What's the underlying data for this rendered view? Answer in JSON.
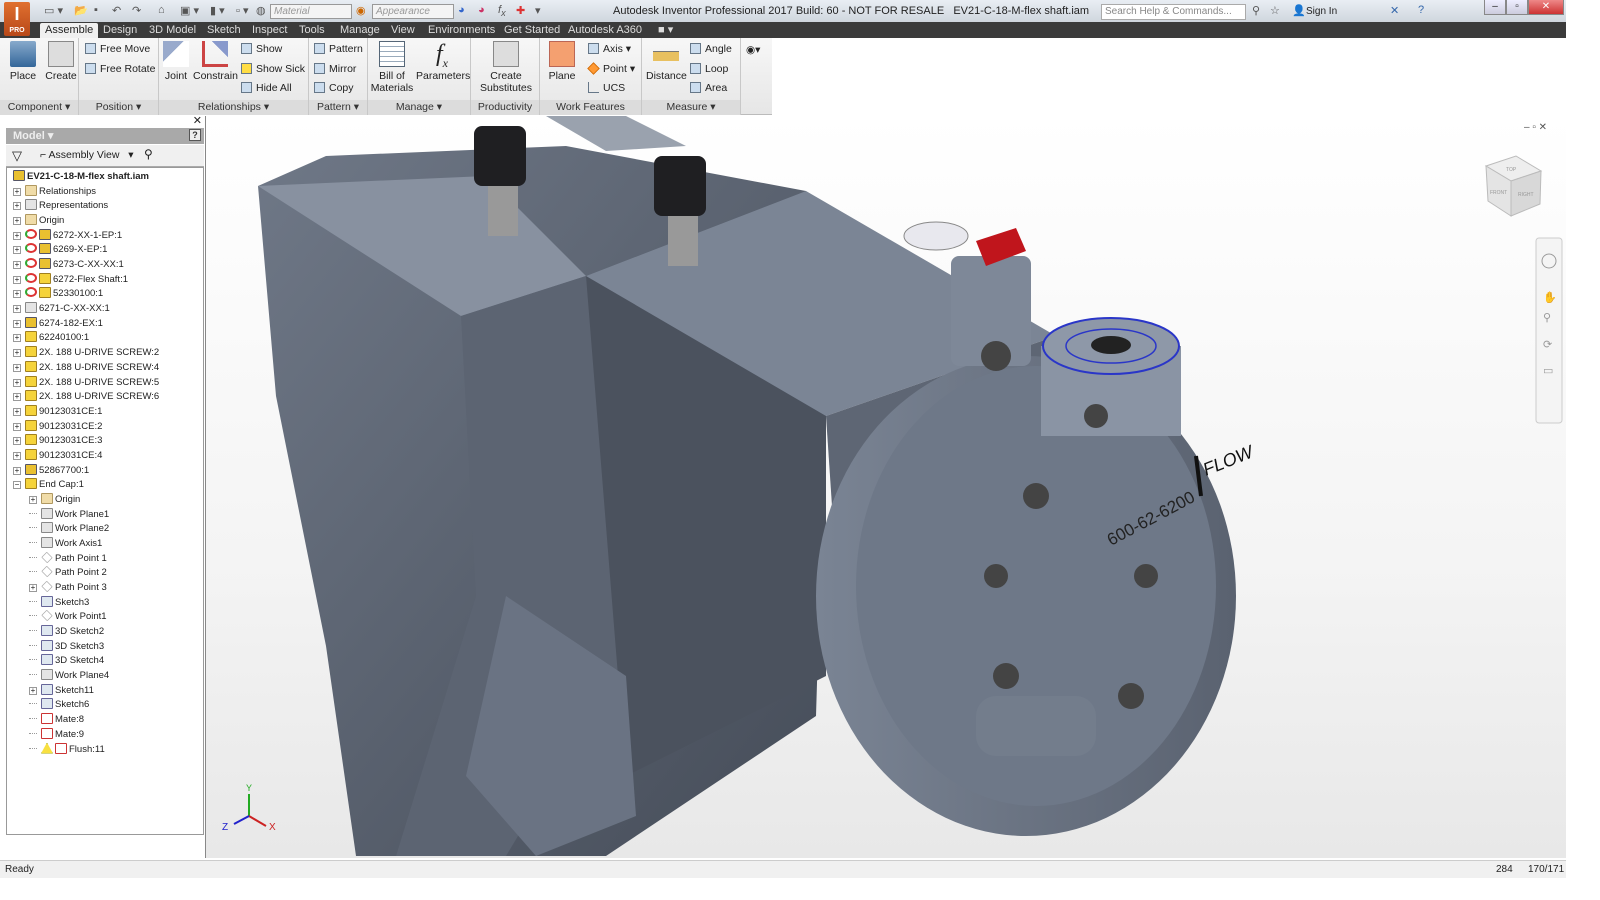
{
  "app": {
    "logo": "I",
    "edition": "PRO",
    "title": "Autodesk Inventor Professional 2017 Build: 60 - NOT FOR RESALE   EV21-C-18-M-flex shaft.iam"
  },
  "qat": {
    "material": "Material",
    "appearance": "Appearance"
  },
  "help": {
    "search_placeholder": "Search Help & Commands...",
    "sign_in": "Sign In"
  },
  "tabs": [
    "Assemble",
    "Design",
    "3D Model",
    "Sketch",
    "Inspect",
    "Tools",
    "Manage",
    "View",
    "Environments",
    "Get Started",
    "Autodesk A360"
  ],
  "ribbon": {
    "component": {
      "title": "Component ▾",
      "place": "Place",
      "create": "Create"
    },
    "position": {
      "title": "Position ▾",
      "free_move": "Free Move",
      "free_rotate": "Free Rotate"
    },
    "relationships": {
      "title": "Relationships ▾",
      "joint": "Joint",
      "constrain": "Constrain",
      "show": "Show",
      "show_sick": "Show Sick",
      "hide_all": "Hide All"
    },
    "pattern": {
      "title": "Pattern ▾",
      "pattern": "Pattern",
      "mirror": "Mirror",
      "copy": "Copy"
    },
    "manage": {
      "title": "Manage ▾",
      "bom": "Bill of Materials",
      "parameters": "Parameters"
    },
    "productivity": {
      "title": "Productivity",
      "create_substitutes": "Create Substitutes"
    },
    "work_features": {
      "title": "Work Features",
      "plane": "Plane",
      "axis": "Axis ▾",
      "point": "Point ▾",
      "ucs": "UCS"
    },
    "measure": {
      "title": "Measure ▾",
      "distance": "Distance",
      "angle": "Angle",
      "loop": "Loop",
      "area": "Area"
    }
  },
  "browser": {
    "header": "Model ▾",
    "view": "Assembly View",
    "tree": [
      {
        "label": "EV21-C-18-M-flex shaft.iam",
        "lvl": 0,
        "icon": "asm",
        "root": true
      },
      {
        "label": "Relationships",
        "lvl": 0,
        "icon": "folder",
        "exp": "+"
      },
      {
        "label": "Representations",
        "lvl": 0,
        "icon": "work",
        "exp": "+"
      },
      {
        "label": "Origin",
        "lvl": 0,
        "icon": "folder",
        "exp": "+"
      },
      {
        "label": "6272-XX-1-EP:1",
        "lvl": 0,
        "icon": "asm",
        "exp": "+",
        "sub": true
      },
      {
        "label": "6269-X-EP:1",
        "lvl": 0,
        "icon": "asm",
        "exp": "+",
        "sub": true
      },
      {
        "label": "6273-C-XX-XX:1",
        "lvl": 0,
        "icon": "asm",
        "exp": "+",
        "sub": true
      },
      {
        "label": "6272-Flex Shaft:1",
        "lvl": 0,
        "icon": "part",
        "exp": "+",
        "sub": true
      },
      {
        "label": "52330100:1",
        "lvl": 0,
        "icon": "part",
        "exp": "+",
        "sub": true
      },
      {
        "label": "6271-C-XX-XX:1",
        "lvl": 0,
        "icon": "work",
        "exp": "+"
      },
      {
        "label": "6274-182-EX:1",
        "lvl": 0,
        "icon": "asm",
        "exp": "+"
      },
      {
        "label": "62240100:1",
        "lvl": 0,
        "icon": "part",
        "exp": "+"
      },
      {
        "label": "2X. 188 U-DRIVE SCREW:2",
        "lvl": 0,
        "icon": "part",
        "exp": "+"
      },
      {
        "label": "2X. 188 U-DRIVE SCREW:4",
        "lvl": 0,
        "icon": "part",
        "exp": "+"
      },
      {
        "label": "2X. 188 U-DRIVE SCREW:5",
        "lvl": 0,
        "icon": "part",
        "exp": "+"
      },
      {
        "label": "2X. 188 U-DRIVE SCREW:6",
        "lvl": 0,
        "icon": "part",
        "exp": "+"
      },
      {
        "label": "90123031CE:1",
        "lvl": 0,
        "icon": "part",
        "exp": "+"
      },
      {
        "label": "90123031CE:2",
        "lvl": 0,
        "icon": "part",
        "exp": "+"
      },
      {
        "label": "90123031CE:3",
        "lvl": 0,
        "icon": "part",
        "exp": "+"
      },
      {
        "label": "90123031CE:4",
        "lvl": 0,
        "icon": "part",
        "exp": "+"
      },
      {
        "label": "52867700:1",
        "lvl": 0,
        "icon": "asm",
        "exp": "+"
      },
      {
        "label": "End Cap:1",
        "lvl": 0,
        "icon": "part",
        "exp": "−"
      },
      {
        "label": "Origin",
        "lvl": 1,
        "icon": "folder",
        "exp": "+"
      },
      {
        "label": "Work Plane1",
        "lvl": 1,
        "icon": "work"
      },
      {
        "label": "Work Plane2",
        "lvl": 1,
        "icon": "work"
      },
      {
        "label": "Work Axis1",
        "lvl": 1,
        "icon": "work"
      },
      {
        "label": "Path Point 1",
        "lvl": 1,
        "icon": "pt"
      },
      {
        "label": "Path Point 2",
        "lvl": 1,
        "icon": "pt"
      },
      {
        "label": "Path Point 3",
        "lvl": 1,
        "icon": "pt",
        "exp": "+"
      },
      {
        "label": "Sketch3",
        "lvl": 1,
        "icon": "sketch"
      },
      {
        "label": "Work Point1",
        "lvl": 1,
        "icon": "pt"
      },
      {
        "label": "3D Sketch2",
        "lvl": 1,
        "icon": "sketch"
      },
      {
        "label": "3D Sketch3",
        "lvl": 1,
        "icon": "sketch"
      },
      {
        "label": "3D Sketch4",
        "lvl": 1,
        "icon": "sketch"
      },
      {
        "label": "Work Plane4",
        "lvl": 1,
        "icon": "work"
      },
      {
        "label": "Sketch11",
        "lvl": 1,
        "icon": "sketch",
        "exp": "+"
      },
      {
        "label": "Sketch6",
        "lvl": 1,
        "icon": "sketch"
      },
      {
        "label": "Mate:8",
        "lvl": 1,
        "icon": "con"
      },
      {
        "label": "Mate:9",
        "lvl": 1,
        "icon": "con"
      },
      {
        "label": "Flush:11",
        "lvl": 1,
        "icon": "con",
        "warn": true
      }
    ]
  },
  "viewport": {
    "part_text": "600-62-6200",
    "flow_text": "FLOW",
    "cube_front": "FRONT",
    "cube_right": "RIGHT",
    "cube_top": "TOP",
    "axis_x": "X",
    "axis_y": "Y",
    "axis_z": "Z"
  },
  "status": {
    "text": "Ready",
    "num1": "284",
    "num2": "170/171"
  }
}
